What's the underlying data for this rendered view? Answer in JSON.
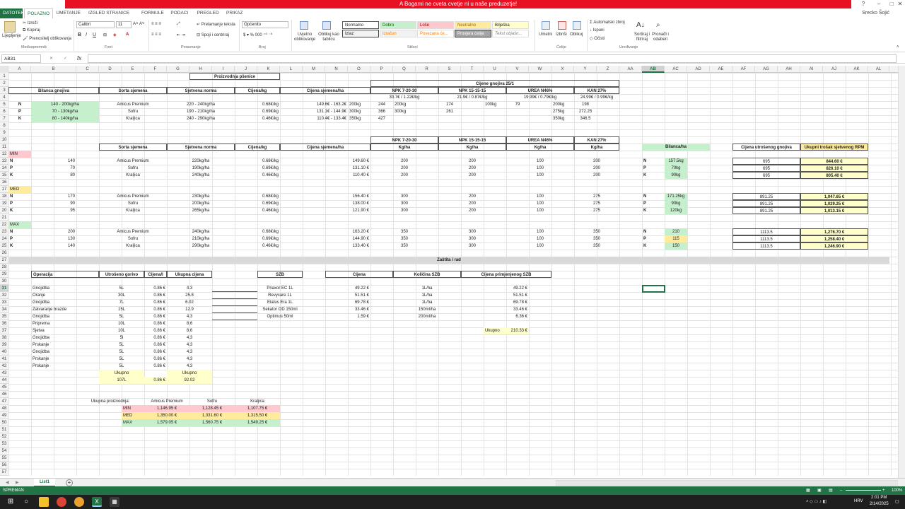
{
  "app": {
    "banner": "A Bogami ne cveta cvetje ni u naše preduzetje!",
    "user": "Srecko Šojić",
    "file_tab": "DATOTEKA",
    "tabs": [
      "POLAZNO",
      "UMETANJE",
      "IZGLED STRANICE",
      "FORMULE",
      "PODACI",
      "PREGLED",
      "PRIKAZ"
    ]
  },
  "ribbon": {
    "clipboard": {
      "paste": "Lijepljenje",
      "cut": "Izreži",
      "copy": "Kopiraj",
      "format_painter": "Prenositelj oblikovanja",
      "label": "Međuspremnik"
    },
    "font": {
      "name": "Calibri",
      "size": "11",
      "label": "Font"
    },
    "alignment": {
      "wrap": "Prelamanje teksta",
      "merge": "Spoji i centriraj",
      "label": "Poravnanje"
    },
    "number": {
      "format": "Općenito",
      "label": "Broj"
    },
    "styles": {
      "cond": "Uvjetno oblikovanje",
      "table": "Oblikuj kao tablicu",
      "label": "Stilovi",
      "cells": [
        "Normalno",
        "Dobro",
        "Loše",
        "Neutralno",
        "Bilješka",
        "Izlaz",
        "Izračun",
        "Povezana će...",
        "Provjera ćelije",
        "Tekst objašn..."
      ]
    },
    "cells": {
      "insert": "Umetni",
      "delete": "Izbriši",
      "format": "Oblikuj",
      "label": "Ćelije"
    },
    "editing": {
      "autosum": "Automatski zbroj",
      "fill": "Ispuni",
      "clear": "Očisti",
      "sort": "Sortiraj i filtriraj",
      "find": "Pronađi i odaberi",
      "label": "Uređivanje"
    }
  },
  "formula_bar": {
    "namebox": "AB31",
    "fx": "fx",
    "value": ""
  },
  "columns": [
    "A",
    "B",
    "C",
    "D",
    "E",
    "F",
    "G",
    "H",
    "I",
    "J",
    "K",
    "L",
    "M",
    "N",
    "O",
    "P",
    "Q",
    "R",
    "S",
    "T",
    "U",
    "V",
    "W",
    "X",
    "Y",
    "Z",
    "AA",
    "AB",
    "AC",
    "AD",
    "AE",
    "AF",
    "AG",
    "AH",
    "AI",
    "AJ",
    "AK",
    "AL"
  ],
  "sheet": {
    "title": "Proizvodnja pšenice",
    "gnojiva_title": "Cijene gnojiva 25/1",
    "hdr_bilanca": "Bilanca gnojiva",
    "hdr_sorta": "Sorta sjemena",
    "hdr_sjetvena": "Sjetvena  norma",
    "hdr_cijena_kg": "Cijena/kg",
    "hdr_cijena_ha": "Cijena sjemena/ha",
    "npk1": "NPK 7-20-30",
    "npk2": "NPK 15-15-15",
    "urea": "UREA N46%",
    "kan": "KAN 27%",
    "npk1_price": "30.7€ / 1.22€/kg",
    "npk2_price": "21.9€ / 0.87€/kg",
    "urea_price": "19.99€ / 0.79€/kg",
    "kan_price": "24.99€ / 0.99€/kg",
    "top_rows": [
      {
        "n": "N",
        "range": "140 - 200kg/ha",
        "sorta": "Amicus Premium",
        "norma": "220 - 240kg/ha",
        "ckg": "0.68€/kg",
        "cha": "149.6€ - 163.2€",
        "q": "200kg",
        "p": "244",
        "r": "200kg",
        "s": "174",
        "u": "100kg",
        "v": "79",
        "x": "200kg",
        "y": "198"
      },
      {
        "n": "P",
        "range": "70 - 130kg/ha",
        "sorta": "Sofru",
        "norma": "190 - 210kg/ha",
        "ckg": "0.69€/kg",
        "cha": "131.1€ - 144.9€",
        "q": "300kg",
        "p": "366",
        "r": "300kg",
        "s": "261",
        "u": "",
        "v": "",
        "x": "275kg",
        "y": "272.25"
      },
      {
        "n": "K",
        "range": "80 - 140kg/ha",
        "sorta": "Kraljica",
        "norma": "240 - 290kg/ha",
        "ckg": "0.46€/kg",
        "cha": "110.4€ - 133.4€",
        "q": "350kg",
        "p": "427",
        "r": "",
        "s": "",
        "u": "",
        "v": "",
        "x": "350kg",
        "y": "346.5"
      }
    ],
    "kgha": "Kg/ha",
    "bilanca_ha": "Bilanca/ha",
    "cijena_gnojiva": "Cijena utrošenog gnojiva",
    "ukupni_trosak": "Ukupni trošak sjetvenog RPM",
    "levels": [
      {
        "label": "MIN",
        "rows": [
          {
            "n": "N",
            "b": "140",
            "sorta": "Amicus Premium",
            "norma": "220kg/ha",
            "ckg": "0.68€/kg",
            "cha": "149.60 €",
            "p": "200",
            "s": "200",
            "v": "100",
            "y": "200",
            "bil": "157.5kg",
            "cg": "695",
            "ut": "844.60 €"
          },
          {
            "n": "P",
            "b": "70",
            "sorta": "Sofru",
            "norma": "190kg/ha",
            "ckg": "0.69€/kg",
            "cha": "131.10 €",
            "p": "200",
            "s": "200",
            "v": "100",
            "y": "200",
            "bil": "70kg",
            "cg": "695",
            "ut": "826.10 €"
          },
          {
            "n": "K",
            "b": "80",
            "sorta": "Kraljica",
            "norma": "240kg/ha",
            "ckg": "0.46€/kg",
            "cha": "110.40 €",
            "p": "200",
            "s": "200",
            "v": "100",
            "y": "200",
            "bil": "90kg",
            "cg": "695",
            "ut": "805.40 €"
          }
        ]
      },
      {
        "label": "MED",
        "rows": [
          {
            "n": "N",
            "b": "170",
            "sorta": "Amicus Premium",
            "norma": "230kg/ha",
            "ckg": "0.68€/kg",
            "cha": "156.40 €",
            "p": "300",
            "s": "200",
            "v": "100",
            "y": "275",
            "bil": "171.25kg",
            "cg": "891.25",
            "ut": "1,047.65 €"
          },
          {
            "n": "P",
            "b": "90",
            "sorta": "Sofru",
            "norma": "200kg/ha",
            "ckg": "0.69€/kg",
            "cha": "138.00 €",
            "p": "300",
            "s": "200",
            "v": "100",
            "y": "275",
            "bil": "90kg",
            "cg": "891.25",
            "ut": "1,029.25 €"
          },
          {
            "n": "K",
            "b": "95",
            "sorta": "Kraljica",
            "norma": "265kg/ha",
            "ckg": "0.46€/kg",
            "cha": "121.90 €",
            "p": "300",
            "s": "200",
            "v": "100",
            "y": "275",
            "bil": "120kg",
            "cg": "891.25",
            "ut": "1,013.15 €"
          }
        ]
      },
      {
        "label": "MAX",
        "rows": [
          {
            "n": "N",
            "b": "200",
            "sorta": "Amicus Premium",
            "norma": "240kg/ha",
            "ckg": "0.68€/kg",
            "cha": "163.20 €",
            "p": "350",
            "s": "300",
            "v": "100",
            "y": "350",
            "bil": "210",
            "cg": "1113.5",
            "ut": "1,276.70 €"
          },
          {
            "n": "P",
            "b": "130",
            "sorta": "Sofru",
            "norma": "210kg/ha",
            "ckg": "0.69€/kg",
            "cha": "144.90 €",
            "p": "350",
            "s": "300",
            "v": "100",
            "y": "350",
            "bil": "115",
            "cg": "1113.5",
            "ut": "1,258.40 €"
          },
          {
            "n": "K",
            "b": "140",
            "sorta": "Kraljica",
            "norma": "290kg/ha",
            "ckg": "0.46€/kg",
            "cha": "133.40 €",
            "p": "350",
            "s": "300",
            "v": "100",
            "y": "350",
            "bil": "150",
            "cg": "1113.5",
            "ut": "1,246.90 €"
          }
        ]
      }
    ],
    "zastita": "Zaštita i rad",
    "ops_hdr": {
      "op": "Operacija",
      "gor": "Utrošeno gorivo",
      "cl": "Cijena/l",
      "uk": "Ukupna cijena",
      "szb": "SZB",
      "cij": "Cijena",
      "kol": "Količina SZB",
      "cps": "Cijena primjenjenog SZB"
    },
    "ops": [
      {
        "op": "Gnojidba",
        "g": "5L",
        "c": "0.86 €",
        "u": "4.3"
      },
      {
        "op": "Oranje",
        "g": "30L",
        "c": "0.86 €",
        "u": "25.8"
      },
      {
        "op": "Gnojidba",
        "g": "7L",
        "c": "0.86 €",
        "u": "6.02"
      },
      {
        "op": "Zatvaranje brazde",
        "g": "15L",
        "c": "0.86 €",
        "u": "12.9"
      },
      {
        "op": "Gnojidba",
        "g": "5L",
        "c": "0.86 €",
        "u": "4.3"
      },
      {
        "op": "Priprema",
        "g": "10L",
        "c": "0.86 €",
        "u": "8.6"
      },
      {
        "op": "Sjetva",
        "g": "10L",
        "c": "0.86 €",
        "u": "8.6"
      },
      {
        "op": "Gnojidba",
        "g": "5l",
        "c": "0.86 €",
        "u": "4.3"
      },
      {
        "op": "Prskanje",
        "g": "5L",
        "c": "0.86 €",
        "u": "4.3"
      },
      {
        "op": "Gnojidba",
        "g": "5L",
        "c": "0.86 €",
        "u": "4.3"
      },
      {
        "op": "Prskanje",
        "g": "5L",
        "c": "0.86 €",
        "u": "4.3"
      },
      {
        "op": "Prskanje",
        "g": "5L",
        "c": "0.86 €",
        "u": "4.3"
      }
    ],
    "szb": [
      {
        "n": "Priaxor EC 1L",
        "c": "49.22 €",
        "k": "1L/ha",
        "p": "49.22 €"
      },
      {
        "n": "Revycare 1L",
        "c": "51.51 €",
        "k": "1L/ha",
        "p": "51.51 €"
      },
      {
        "n": "Elatus Era 1L",
        "c": "69.78 €",
        "k": "1L/ha",
        "p": "69.78 €"
      },
      {
        "n": "Sekator OD 150ml",
        "c": "33.46 €",
        "k": "150ml/ha",
        "p": "33.46 €"
      },
      {
        "n": "Optimus 50ml",
        "c": "1.59 €",
        "k": "200ml/ha",
        "p": "6.36 €"
      }
    ],
    "ukupno": "Ukupno",
    "szb_total": "210.33 €",
    "gor_total": "107L",
    "cl_total": "0.86 €",
    "uk_total": "92.02",
    "up_label": "Ukupna proizvodnja:",
    "up_cols": [
      "Amicus Premium",
      "Sofru",
      "Kraljica"
    ],
    "up_rows": [
      {
        "l": "MIN",
        "v": [
          "1,146.95 €",
          "1,128.45 €",
          "1,107.75 €"
        ]
      },
      {
        "l": "MED",
        "v": [
          "1,350.00 €",
          "1,331.60 €",
          "1,315.50 €"
        ]
      },
      {
        "l": "MAX",
        "v": [
          "1,579.05 €",
          "1,560.75 €",
          "1,549.25 €"
        ]
      }
    ]
  },
  "sheet_tab": "List1",
  "status": {
    "left": "SPREMAN",
    "zoom": "100%"
  },
  "taskbar": {
    "time": "2:01 PM",
    "date": "2/14/2025",
    "lang": "HRV"
  }
}
